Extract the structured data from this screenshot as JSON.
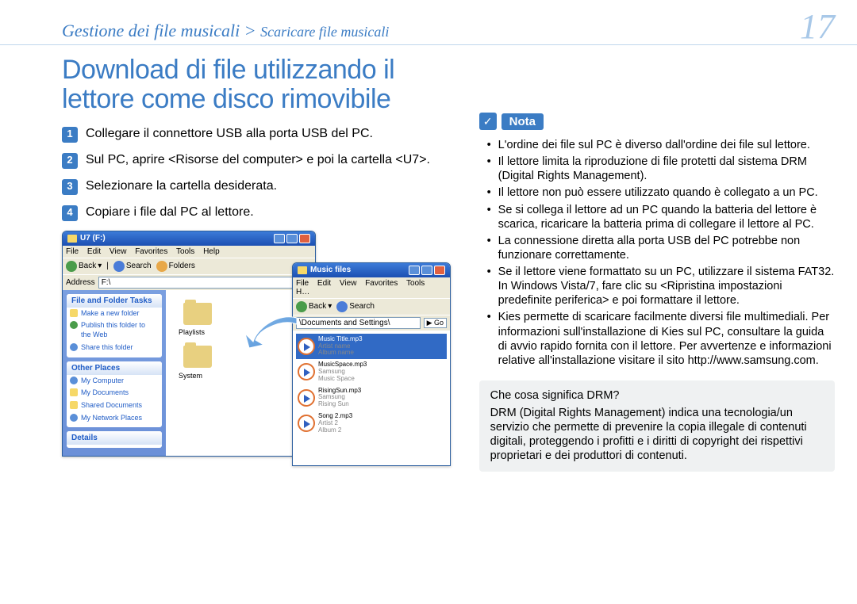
{
  "header": {
    "breadcrumb_main": "Gestione dei file musicali > ",
    "breadcrumb_sub": "Scaricare file musicali",
    "page_number": "17"
  },
  "heading": "Download di file utilizzando il lettore come disco rimovibile",
  "steps": [
    {
      "n": "1",
      "text": "Collegare il connettore USB alla porta USB del PC."
    },
    {
      "n": "2",
      "text": "Sul PC, aprire <Risorse del computer> e poi la cartella <U7>."
    },
    {
      "n": "3",
      "text": "Selezionare la cartella desiderata."
    },
    {
      "n": "4",
      "text": "Copiare i file dal PC al lettore."
    }
  ],
  "screenshot": {
    "main_window": {
      "title": "U7 (F:)",
      "menus": [
        "File",
        "Edit",
        "View",
        "Favorites",
        "Tools",
        "Help"
      ],
      "toolbar": {
        "back": "Back",
        "search": "Search",
        "folders": "Folders"
      },
      "address_label": "Address",
      "address_value": "F:\\",
      "sidebar": {
        "panel1_title": "File and Folder Tasks",
        "panel1_items": [
          "Make a new folder",
          "Publish this folder to the Web",
          "Share this folder"
        ],
        "panel2_title": "Other Places",
        "panel2_items": [
          "My Computer",
          "My Documents",
          "Shared Documents",
          "My Network Places"
        ],
        "panel3_title": "Details"
      },
      "folders": [
        "Playlists",
        "System"
      ]
    },
    "music_window": {
      "title": "Music files",
      "menus": [
        "File",
        "Edit",
        "View",
        "Favorites",
        "Tools",
        "H…"
      ],
      "toolbar": {
        "back": "Back",
        "search": "Search"
      },
      "address_value": "\\Documents and Settings\\",
      "go": "Go",
      "items": [
        {
          "title": "Music Title.mp3",
          "sub1": "Artist name",
          "sub2": "Album name",
          "selected": true
        },
        {
          "title": "MusicSpace.mp3",
          "sub1": "Samsung",
          "sub2": "Music Space",
          "selected": false
        },
        {
          "title": "RisingSun.mp3",
          "sub1": "Samsung",
          "sub2": "Rising Sun",
          "selected": false
        },
        {
          "title": "Song 2.mp3",
          "sub1": "Artist 2",
          "sub2": "Album 2",
          "selected": false
        }
      ]
    }
  },
  "nota": {
    "label": "Nota",
    "items": [
      "L'ordine dei file sul PC è diverso dall'ordine dei file sul lettore.",
      "Il lettore limita la riproduzione di file protetti dal sistema DRM (Digital Rights Management).",
      "Il lettore non può essere utilizzato quando è collegato a un PC.",
      "Se si collega il lettore ad un PC quando la batteria del lettore è scarica, ricaricare la batteria prima di collegare il lettore al PC.",
      "La connessione diretta alla porta USB del PC potrebbe non funzionare correttamente.",
      "Se il lettore viene formattato su un PC, utilizzare il sistema FAT32. In Windows Vista/7, fare clic su <Ripristina impostazioni predefinite periferica> e poi formattare il lettore.",
      "Kies permette di scaricare facilmente diversi file multimediali. Per informazioni sull'installazione di Kies sul PC, consultare la guida di avvio rapido fornita con il lettore. Per avvertenze e informazioni relative all'installazione visitare il sito http://www.samsung.com."
    ]
  },
  "drm": {
    "title": "Che cosa significa DRM?",
    "body": "DRM (Digital Rights Management) indica una tecnologia/un servizio che permette di prevenire la copia illegale di contenuti digitali, proteggendo i profitti e i diritti di copyright dei rispettivi proprietari e dei produttori di contenuti."
  }
}
